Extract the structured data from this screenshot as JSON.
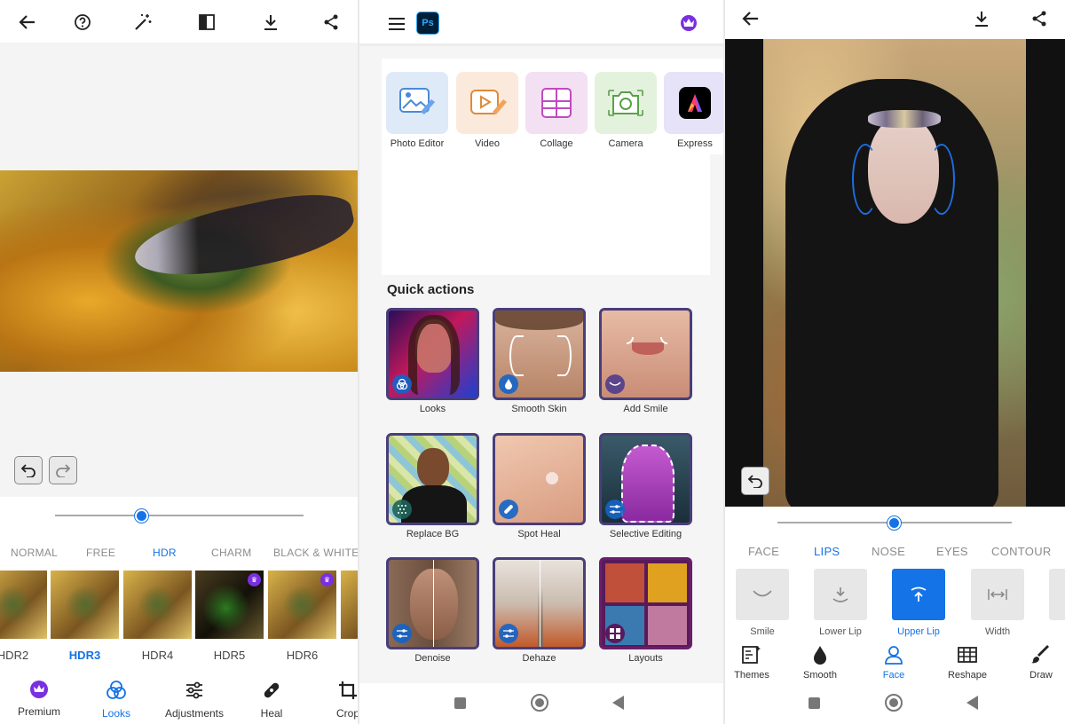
{
  "colors": {
    "accent": "#1473e6",
    "premium": "#7a2fe0"
  },
  "editor_looks": {
    "toolbar_icons": [
      "back-arrow-icon",
      "help-icon",
      "magic-wand-icon",
      "compare-icon",
      "download-icon",
      "share-icon"
    ],
    "slider_value": 0.35,
    "categories": [
      {
        "label": "NORMAL",
        "active": false
      },
      {
        "label": "FREE",
        "active": false
      },
      {
        "label": "HDR",
        "active": true
      },
      {
        "label": "CHARM",
        "active": false
      },
      {
        "label": "BLACK & WHITE",
        "active": false
      }
    ],
    "thumbnails": [
      {
        "label": "HDR2",
        "premium": false,
        "active": false
      },
      {
        "label": "HDR3",
        "premium": false,
        "active": true
      },
      {
        "label": "HDR4",
        "premium": false,
        "active": false
      },
      {
        "label": "HDR5",
        "premium": true,
        "active": false
      },
      {
        "label": "HDR6",
        "premium": true,
        "active": false
      }
    ],
    "nav": [
      {
        "label": "Premium",
        "icon": "crown-icon",
        "active": false
      },
      {
        "label": "Looks",
        "icon": "looks-icon",
        "active": true
      },
      {
        "label": "Adjustments",
        "icon": "sliders-icon",
        "active": false
      },
      {
        "label": "Heal",
        "icon": "bandage-icon",
        "active": false
      },
      {
        "label": "Crop",
        "icon": "crop-icon",
        "active": false
      }
    ]
  },
  "home": {
    "logo_text": "Ps",
    "tools": [
      {
        "label": "Photo Editor",
        "color": "#dfeaf8"
      },
      {
        "label": "Video",
        "color": "#fbeadc"
      },
      {
        "label": "Collage",
        "color": "#f3e0f3"
      },
      {
        "label": "Camera",
        "color": "#e3f2dc"
      },
      {
        "label": "Express",
        "color": "#e6e2f8"
      }
    ],
    "quick_actions_title": "Quick actions",
    "quick_actions": [
      {
        "label": "Looks",
        "icon": "looks-icon"
      },
      {
        "label": "Smooth Skin",
        "icon": "drop-icon"
      },
      {
        "label": "Add Smile",
        "icon": "smile-icon"
      },
      {
        "label": "Replace BG",
        "icon": "pattern-icon"
      },
      {
        "label": "Spot Heal",
        "icon": "bandage-icon"
      },
      {
        "label": "Selective Editing",
        "icon": "sliders-icon"
      },
      {
        "label": "Denoise",
        "icon": "sliders-icon"
      },
      {
        "label": "Dehaze",
        "icon": "sliders-icon"
      },
      {
        "label": "Layouts",
        "icon": "layout-icon"
      }
    ]
  },
  "editor_face": {
    "slider_value": 0.5,
    "tabs": [
      {
        "label": "FACE",
        "active": false
      },
      {
        "label": "LIPS",
        "active": true
      },
      {
        "label": "NOSE",
        "active": false
      },
      {
        "label": "EYES",
        "active": false
      },
      {
        "label": "CONTOUR",
        "active": false
      }
    ],
    "features": [
      {
        "label": "Smile",
        "active": false
      },
      {
        "label": "Lower Lip",
        "active": false
      },
      {
        "label": "Upper Lip",
        "active": true
      },
      {
        "label": "Width",
        "active": false
      }
    ],
    "nav": [
      {
        "label": "Themes",
        "icon": "themes-icon",
        "active": false
      },
      {
        "label": "Smooth",
        "icon": "drop-icon",
        "active": false
      },
      {
        "label": "Face",
        "icon": "person-icon",
        "active": true
      },
      {
        "label": "Reshape",
        "icon": "grid-icon",
        "active": false
      },
      {
        "label": "Draw",
        "icon": "brush-icon",
        "active": false
      }
    ]
  }
}
